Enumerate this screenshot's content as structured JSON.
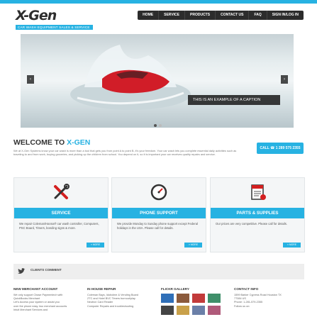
{
  "brand": {
    "logo_text": "X-Gen",
    "tagline": "CAR WASH EQUIPMENT SALES & SERVICE",
    "accent_color": "#27b2e2"
  },
  "nav": {
    "items": [
      "HOME",
      "SERVICE",
      "PRODUCTS",
      "CONTACT US",
      "FAQ",
      "SIGN IN/LOG IN"
    ]
  },
  "slider": {
    "caption": "THIS IS AN EXAMPLE OF A CAPTION",
    "prev_icon": "‹",
    "next_icon": "›"
  },
  "welcome": {
    "title_prefix": "WELCOME TO ",
    "title_brand": "X-GEN",
    "text": "We at X-Gen Systems know your car wash is more than a tool that gets you from point A to point B, it's your freedom. Your car wash lets you complete essential daily activities such as traveling to and from work, buying groceries, and picking up the children from school. You depend on it, so it is important your car receives quality repairs and service.",
    "call_label": "CALL ☎ 1 289 575 2355"
  },
  "features": [
    {
      "title": "SERVICE",
      "text": "We repair Coleman/Hanna® car wash controller, Computers, PSC Board, Timers, bonding signs & more.",
      "more": "» MORE"
    },
    {
      "title": "PHONE SUPPORT",
      "text": "We provide Monday to Sunday phone support except Federal holidays in the USA. Please call for details.",
      "more": "» MORE"
    },
    {
      "title": "PARTS & SUPPLIES",
      "text": "Our prices are very competitive. Please call for details.",
      "more": "» MORE"
    }
  ],
  "clients": {
    "label": "CLIENTS COMMENT"
  },
  "footer": {
    "merchant": {
      "title": "NEW MERCHANT ACCOUNT",
      "lines": [
        "We only support Chase Paymentech with",
        "QuickBooks Merchant",
        "Let's Access your system or assist you",
        "over the phone easy. two merchant accounts",
        "Intuit Merchant Services and"
      ]
    },
    "repair": {
      "title": "IN HOUSE REPAIR",
      "lines": [
        "Coleman Bays, Idobolme & Vending Board",
        "ZTC and Hotel BVC Timers burnout/play",
        "Neutron Card Reader",
        "Computer Repairs and troubleshooting"
      ]
    },
    "gallery": {
      "title": "FLICKR GALLERY"
    },
    "contact": {
      "title": "CONTACT INFO",
      "lines": [
        "1599 Barker Cypress Road Houston TX",
        "77084 US",
        "Phone: 1-281-579-2355",
        "Follow us on:"
      ]
    }
  }
}
